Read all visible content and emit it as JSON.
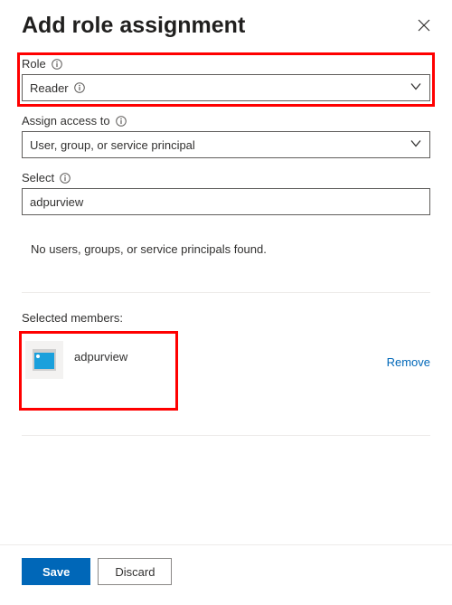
{
  "title": "Add role assignment",
  "role": {
    "label": "Role",
    "value": "Reader"
  },
  "assignAccess": {
    "label": "Assign access to",
    "value": "User, group, or service principal"
  },
  "select": {
    "label": "Select",
    "value": "adpurview"
  },
  "noResults": "No users, groups, or service principals found.",
  "membersLabel": "Selected members:",
  "member": {
    "name": "adpurview",
    "removeLabel": "Remove"
  },
  "buttons": {
    "save": "Save",
    "discard": "Discard"
  }
}
